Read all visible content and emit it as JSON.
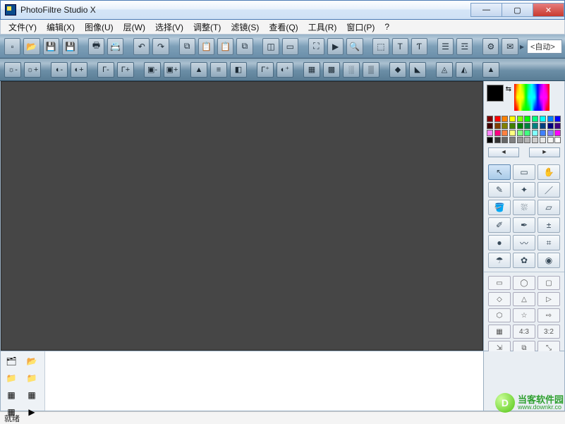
{
  "title": "PhotoFiltre Studio X",
  "win_buttons": {
    "min": "—",
    "max": "▢",
    "close": "✕"
  },
  "menus": [
    "文件(Y)",
    "编辑(X)",
    "图像(U)",
    "层(W)",
    "选择(V)",
    "调整(T)",
    "滤镜(S)",
    "查看(Q)",
    "工具(R)",
    "窗口(P)",
    "?"
  ],
  "toolbar1_icons": [
    "new-icon",
    "open-icon",
    "save-icon",
    "save-as-icon",
    "print-icon",
    "scanner-icon",
    "undo-icon",
    "redo-icon",
    "copy-icon",
    "paste-icon",
    "paste-special-icon",
    "clone-icon",
    "image-size-icon",
    "canvas-size-icon",
    "fullscreen-icon",
    "slideshow-icon",
    "zoom-fit-icon",
    "select-all-icon",
    "text-icon",
    "text-tool-icon",
    "layer-new-icon",
    "layer-manager-icon",
    "automate-icon",
    "preferences-icon"
  ],
  "toolbar1_auto_label": "<自动>",
  "toolbar2_icons": [
    "brightness-minus-icon",
    "brightness-plus-icon",
    "contrast-minus-icon",
    "contrast-plus-icon",
    "gamma-minus-icon",
    "gamma-plus-icon",
    "saturation-minus-icon",
    "saturation-plus-icon",
    "histogram-icon",
    "levels-icon",
    "grayscale-icon",
    "auto-levels-icon",
    "auto-contrast-icon",
    "dither-icon",
    "posterize-icon",
    "noise-icon",
    "blur-icon",
    "sharpen-icon",
    "gradient-icon",
    "variations-l-icon",
    "variations-r-icon",
    "photo-mask-icon",
    "vsep"
  ],
  "palette_colors": [
    "#800000",
    "#ff0000",
    "#ff8000",
    "#ffff00",
    "#80ff00",
    "#00ff00",
    "#00ff80",
    "#00ffff",
    "#0080ff",
    "#0000ff",
    "#400000",
    "#804000",
    "#808000",
    "#408000",
    "#008000",
    "#008040",
    "#008080",
    "#004080",
    "#000080",
    "#400080",
    "#ff80ff",
    "#ff0080",
    "#ff8040",
    "#ffff80",
    "#80ff80",
    "#40ff80",
    "#80ffff",
    "#4080ff",
    "#8080ff",
    "#ff00ff",
    "#000000",
    "#333333",
    "#666666",
    "#808080",
    "#999999",
    "#b3b3b3",
    "#cccccc",
    "#e6e6e6",
    "#f2f2f2",
    "#ffffff"
  ],
  "pal_prev": "◄",
  "pal_next": "►",
  "tools": [
    {
      "name": "pointer-tool-icon",
      "glyph": "↖",
      "sel": true
    },
    {
      "name": "rect-select-tool-icon",
      "glyph": "▭"
    },
    {
      "name": "hand-tool-icon",
      "glyph": "✋"
    },
    {
      "name": "eyedropper-tool-icon",
      "glyph": "✎"
    },
    {
      "name": "wand-tool-icon",
      "glyph": "✦"
    },
    {
      "name": "line-tool-icon",
      "glyph": "／"
    },
    {
      "name": "fill-tool-icon",
      "glyph": "🪣"
    },
    {
      "name": "spray-tool-icon",
      "glyph": "⛆"
    },
    {
      "name": "eraser-tool-icon",
      "glyph": "▱"
    },
    {
      "name": "brush-tool-icon",
      "glyph": "✐"
    },
    {
      "name": "advbrush-tool-icon",
      "glyph": "✒"
    },
    {
      "name": "stamp-tool-icon",
      "glyph": "±"
    },
    {
      "name": "blur-tool-icon",
      "glyph": "●"
    },
    {
      "name": "smudge-tool-icon",
      "glyph": "〰"
    },
    {
      "name": "clone-tool-icon",
      "glyph": "⌗"
    },
    {
      "name": "retouch-tool-icon",
      "glyph": "☂"
    },
    {
      "name": "art-tool-icon",
      "glyph": "✿"
    },
    {
      "name": "deform-tool-icon",
      "glyph": "◉"
    }
  ],
  "shapes": [
    {
      "name": "shape-rect-icon",
      "glyph": "▭"
    },
    {
      "name": "shape-ellipse-icon",
      "glyph": "◯"
    },
    {
      "name": "shape-roundrect-icon",
      "glyph": "▢"
    },
    {
      "name": "shape-diamond-icon",
      "glyph": "◇"
    },
    {
      "name": "shape-triangle-icon",
      "glyph": "△"
    },
    {
      "name": "shape-rtriangle-icon",
      "glyph": "▷"
    },
    {
      "name": "shape-hex-icon",
      "glyph": "⬡"
    },
    {
      "name": "shape-star-icon",
      "glyph": "☆"
    },
    {
      "name": "shape-arrow-icon",
      "glyph": "⇨"
    },
    {
      "name": "ratio-free-icon",
      "glyph": "▦"
    },
    {
      "name": "ratio-43-icon",
      "glyph": "4:3"
    },
    {
      "name": "ratio-32-icon",
      "glyph": "3:2"
    },
    {
      "name": "ratio-i-icon",
      "glyph": "⇲"
    },
    {
      "name": "ratio-crop-icon",
      "glyph": "⧉"
    },
    {
      "name": "ratio-lock-icon",
      "glyph": "⤡"
    }
  ],
  "explorer_icons": [
    {
      "name": "explorer-tree-icon",
      "g": "🗂"
    },
    {
      "name": "explorer-add-icon",
      "g": "📂"
    },
    {
      "name": "explorer-yellow1-icon",
      "g": "📁"
    },
    {
      "name": "explorer-yellow2-icon",
      "g": "📁"
    },
    {
      "name": "explorer-checker-icon",
      "g": "▦"
    },
    {
      "name": "explorer-checker2-icon",
      "g": "▦"
    },
    {
      "name": "explorer-refresh-icon",
      "g": "▦"
    },
    {
      "name": "explorer-play-icon",
      "g": "▶"
    }
  ],
  "status": "就绪",
  "watermark": {
    "cn": "当客软件园",
    "en": "www.downkr.co"
  }
}
